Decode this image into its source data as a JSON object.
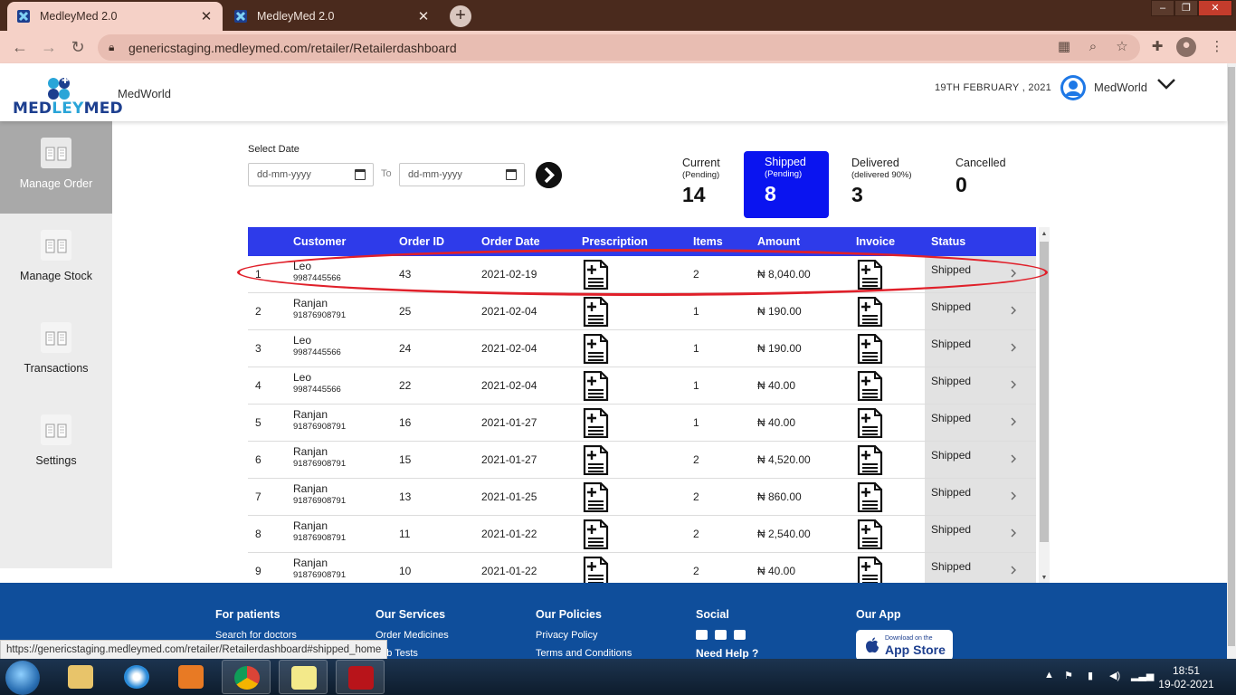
{
  "browser": {
    "tabs": [
      {
        "title": "MedleyMed 2.0",
        "active": true
      },
      {
        "title": "MedleyMed 2.0",
        "active": false
      }
    ],
    "new_tab": "+",
    "url": "genericstaging.medleymed.com/retailer/Retailerdashboard",
    "status_url": "https://genericstaging.medleymed.com/retailer/Retailerdashboard#shipped_home"
  },
  "header": {
    "logo_text_1": "MED",
    "logo_text_2": "LEY",
    "logo_text_3": "MED",
    "brand": "MedWorld",
    "date": "19TH FEBRUARY , 2021",
    "user": "MedWorld"
  },
  "sidebar": {
    "items": [
      {
        "label": "Manage Order",
        "active": true
      },
      {
        "label": "Manage Stock",
        "active": false
      },
      {
        "label": "Transactions",
        "active": false
      },
      {
        "label": "Settings",
        "active": false
      }
    ]
  },
  "filters": {
    "select_date_label": "Select Date",
    "from_placeholder": "dd-mm-yyyy",
    "to_label": "To",
    "to_placeholder": "dd-mm-yyyy"
  },
  "counters": [
    {
      "label": "Current",
      "sub": "(Pending)",
      "count": "14",
      "active": false
    },
    {
      "label": "Shipped",
      "sub": "(Pending)",
      "count": "8",
      "active": true
    },
    {
      "label": "Delivered",
      "sub": "(delivered 90%)",
      "count": "3",
      "active": false
    },
    {
      "label": "Cancelled",
      "sub": "",
      "count": "0",
      "active": false
    }
  ],
  "table": {
    "columns": [
      "Customer",
      "Order ID",
      "Order Date",
      "Prescription",
      "Items",
      "Amount",
      "Invoice",
      "Status"
    ],
    "rows": [
      {
        "n": "1",
        "name": "Leo",
        "phone": "9987445566",
        "order_id": "43",
        "date": "2021-02-19",
        "items": "2",
        "amount": "₦ 8,040.00",
        "status": "Shipped"
      },
      {
        "n": "2",
        "name": "Ranjan",
        "phone": "91876908791",
        "order_id": "25",
        "date": "2021-02-04",
        "items": "1",
        "amount": "₦ 190.00",
        "status": "Shipped"
      },
      {
        "n": "3",
        "name": "Leo",
        "phone": "9987445566",
        "order_id": "24",
        "date": "2021-02-04",
        "items": "1",
        "amount": "₦ 190.00",
        "status": "Shipped"
      },
      {
        "n": "4",
        "name": "Leo",
        "phone": "9987445566",
        "order_id": "22",
        "date": "2021-02-04",
        "items": "1",
        "amount": "₦ 40.00",
        "status": "Shipped"
      },
      {
        "n": "5",
        "name": "Ranjan",
        "phone": "91876908791",
        "order_id": "16",
        "date": "2021-01-27",
        "items": "1",
        "amount": "₦ 40.00",
        "status": "Shipped"
      },
      {
        "n": "6",
        "name": "Ranjan",
        "phone": "91876908791",
        "order_id": "15",
        "date": "2021-01-27",
        "items": "2",
        "amount": "₦ 4,520.00",
        "status": "Shipped"
      },
      {
        "n": "7",
        "name": "Ranjan",
        "phone": "91876908791",
        "order_id": "13",
        "date": "2021-01-25",
        "items": "2",
        "amount": "₦ 860.00",
        "status": "Shipped"
      },
      {
        "n": "8",
        "name": "Ranjan",
        "phone": "91876908791",
        "order_id": "11",
        "date": "2021-01-22",
        "items": "2",
        "amount": "₦ 2,540.00",
        "status": "Shipped"
      },
      {
        "n": "9",
        "name": "Ranjan",
        "phone": "91876908791",
        "order_id": "10",
        "date": "2021-01-22",
        "items": "2",
        "amount": "₦ 40.00",
        "status": "Shipped"
      }
    ]
  },
  "footer": {
    "patients": {
      "title": "For patients",
      "links": [
        "Search for doctors"
      ]
    },
    "services": {
      "title": "Our Services",
      "links": [
        "Order Medicines",
        "Lab Tests"
      ]
    },
    "policies": {
      "title": "Our Policies",
      "links": [
        "Privacy Policy",
        "Terms and Conditions"
      ]
    },
    "social": {
      "title": "Social",
      "help": "Need Help ?"
    },
    "app": {
      "title": "Our App",
      "store_small": "Download on the",
      "store_big": "App Store"
    }
  },
  "taskbar": {
    "time": "18:51",
    "date": "19-02-2021"
  },
  "colors": {
    "table_header": "#2e3bea",
    "active_counter": "#0a14f0",
    "footer": "#0f4e9b",
    "highlight": "#e0202a"
  }
}
